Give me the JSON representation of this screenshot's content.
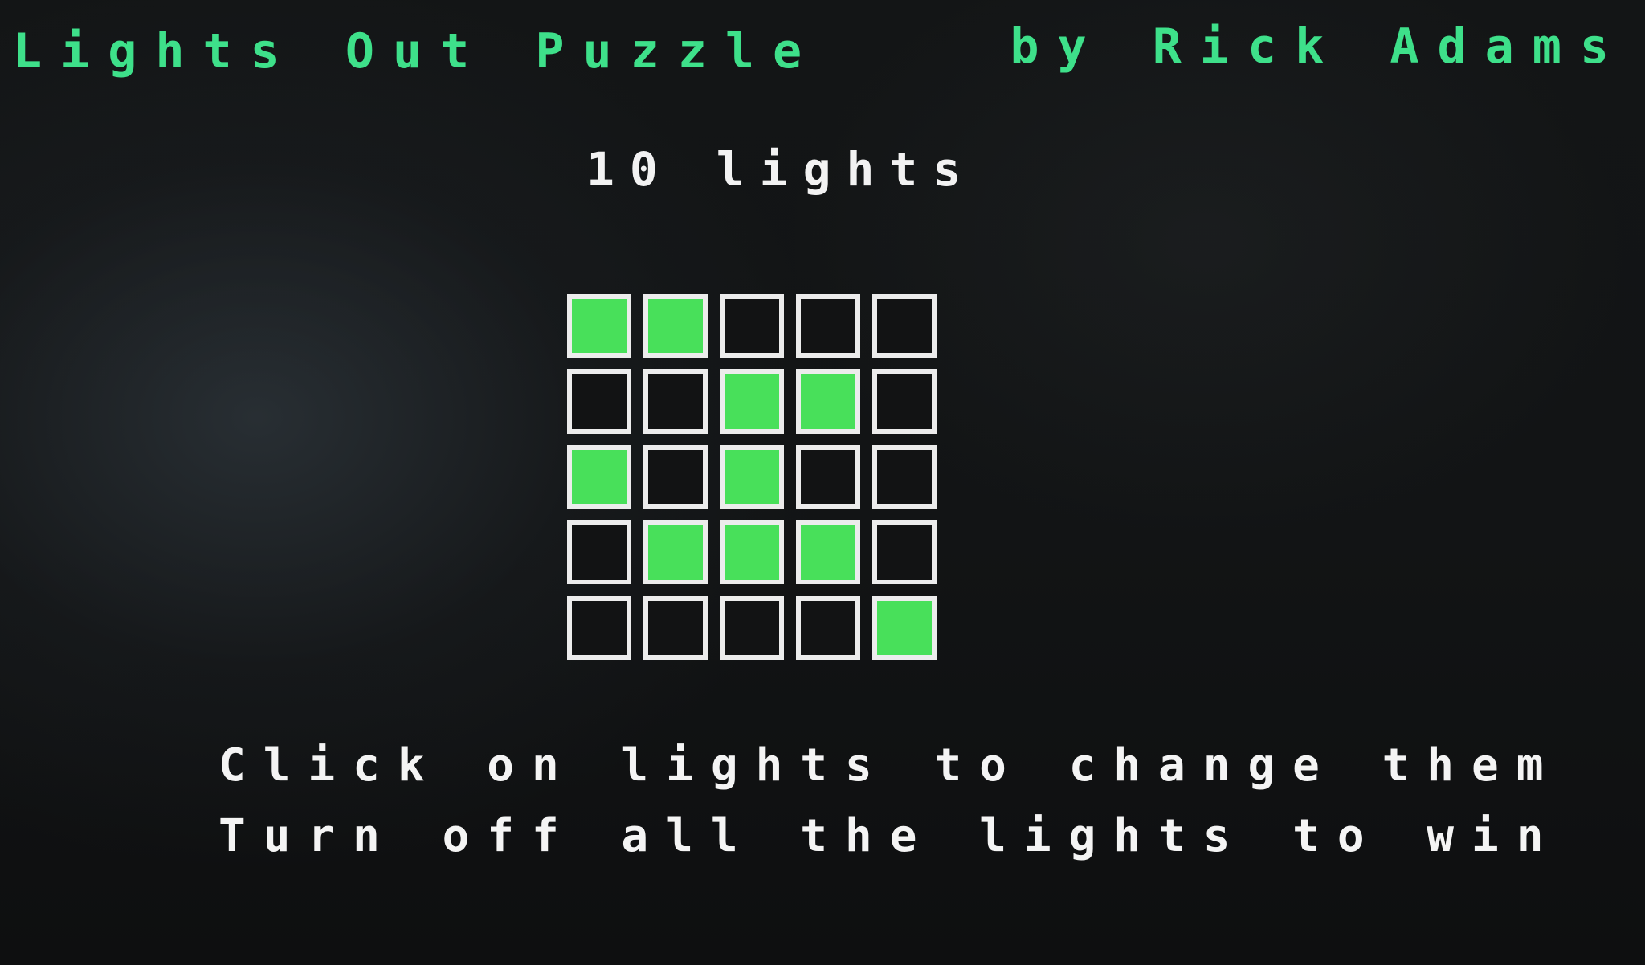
{
  "header": {
    "title": "Lights Out Puzzle",
    "author": "by Rick Adams"
  },
  "status": {
    "lights_count": "10 lights"
  },
  "board": {
    "rows": [
      [
        true,
        true,
        false,
        false,
        false
      ],
      [
        false,
        false,
        true,
        true,
        false
      ],
      [
        true,
        false,
        true,
        false,
        false
      ],
      [
        false,
        true,
        true,
        true,
        false
      ],
      [
        false,
        false,
        false,
        false,
        true
      ]
    ]
  },
  "instructions": {
    "line1": "Click on lights to change them",
    "line2": "Turn off all the lights to win"
  },
  "colors": {
    "title_green": "#3ee08a",
    "light_on": "#48e05a",
    "cell_border": "#ececec"
  }
}
